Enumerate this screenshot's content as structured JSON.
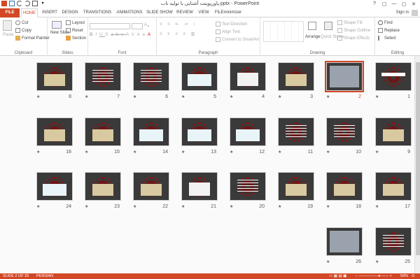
{
  "title": "پاورپوینت آشنایی با تولید ناب.pptx - PowerPoint",
  "window_controls": [
    "?",
    "▢",
    "—",
    "▢",
    "✕"
  ],
  "tabs": [
    "FILE",
    "HOME",
    "INSERT",
    "DESIGN",
    "TRANSITIONS",
    "ANIMATIONS",
    "SLIDE SHOW",
    "REVIEW",
    "VIEW",
    "FILEminimizer"
  ],
  "active_tab": "HOME",
  "signin": "Sign in",
  "ribbon": {
    "clipboard": {
      "label": "Clipboard",
      "paste": "Paste",
      "cut": "Cut",
      "copy": "Copy",
      "format_painter": "Format Painter"
    },
    "slides": {
      "label": "Slides",
      "new_slide": "New Slide",
      "layout": "Layout",
      "reset": "Reset",
      "section": "Section"
    },
    "font": {
      "label": "Font",
      "buttons": [
        "B",
        "I",
        "U",
        "S",
        "abc",
        "AV",
        "Aa",
        "A"
      ]
    },
    "paragraph": {
      "label": "Paragraph",
      "text_direction": "Text Direction",
      "align_text": "Align Text",
      "convert_smartart": "Convert to SmartArt"
    },
    "drawing": {
      "label": "Drawing",
      "arrange": "Arrange",
      "quick_styles": "Quick Styles",
      "shape_fill": "Shape Fill",
      "shape_outline": "Shape Outline",
      "shape_effects": "Shape Effects"
    },
    "editing": {
      "label": "Editing",
      "find": "Find",
      "replace": "Replace",
      "select": "Select"
    }
  },
  "slides": [
    {
      "n": "1",
      "kind": "title",
      "selected": false
    },
    {
      "n": "2",
      "kind": "photo",
      "selected": true
    },
    {
      "n": "3",
      "kind": "image",
      "selected": false
    },
    {
      "n": "4",
      "kind": "chart",
      "selected": false
    },
    {
      "n": "5",
      "kind": "diagram",
      "selected": false
    },
    {
      "n": "6",
      "kind": "text",
      "selected": false
    },
    {
      "n": "7",
      "kind": "text",
      "selected": false
    },
    {
      "n": "8",
      "kind": "image",
      "selected": false
    },
    {
      "n": "9",
      "kind": "image",
      "selected": false
    },
    {
      "n": "10",
      "kind": "text",
      "selected": false
    },
    {
      "n": "11",
      "kind": "text",
      "selected": false
    },
    {
      "n": "12",
      "kind": "diagram",
      "selected": false
    },
    {
      "n": "13",
      "kind": "diagram",
      "selected": false
    },
    {
      "n": "14",
      "kind": "diagram",
      "selected": false
    },
    {
      "n": "15",
      "kind": "image",
      "selected": false
    },
    {
      "n": "16",
      "kind": "image",
      "selected": false
    },
    {
      "n": "17",
      "kind": "image",
      "selected": false
    },
    {
      "n": "18",
      "kind": "image",
      "selected": false
    },
    {
      "n": "19",
      "kind": "image",
      "selected": false
    },
    {
      "n": "20",
      "kind": "text",
      "selected": false
    },
    {
      "n": "21",
      "kind": "chart",
      "selected": false
    },
    {
      "n": "22",
      "kind": "image",
      "selected": false
    },
    {
      "n": "23",
      "kind": "image",
      "selected": false
    },
    {
      "n": "24",
      "kind": "diagram",
      "selected": false
    },
    {
      "n": "25",
      "kind": "text",
      "selected": false
    },
    {
      "n": "26",
      "kind": "photo",
      "selected": false
    }
  ],
  "status": {
    "slide": "SLIDE 2 OF 26",
    "language": "PERSIAN",
    "zoom": "50%"
  },
  "colors": {
    "accent": "#d24726",
    "slide_bg": "#3a3a3a",
    "gear": "#6e1616"
  }
}
